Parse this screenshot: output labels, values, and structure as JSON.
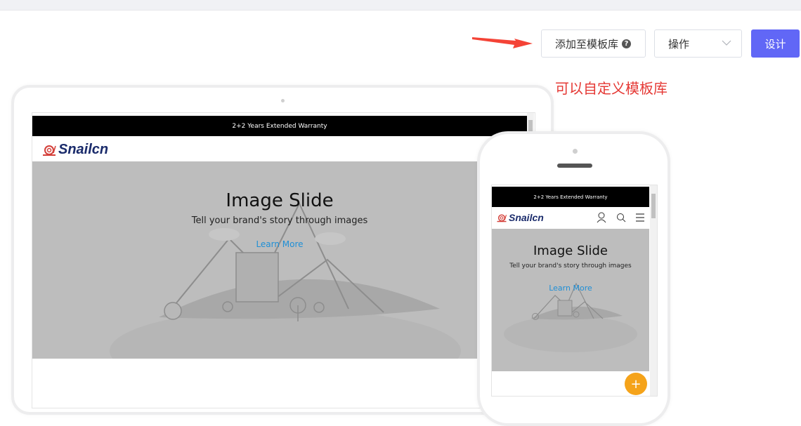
{
  "toolbar": {
    "add_template_label": "添加至模板库",
    "help_glyph": "?",
    "operations_label": "操作",
    "design_label": "设计"
  },
  "annotation": {
    "note": "可以自定义模板库"
  },
  "colors": {
    "primary": "#6167f6",
    "note_red": "#e53935",
    "arrow_red": "#f44336",
    "fab_orange": "#f5a31a",
    "hero_gray": "#bdbdbd"
  },
  "preview_desktop": {
    "announcement": "2+2 Years Extended Warranty",
    "logo": "Snailcn",
    "hero_title": "Image Slide",
    "hero_subtitle": "Tell your brand's story through images",
    "hero_link": "Learn More"
  },
  "preview_mobile": {
    "announcement": "2+2 Years Extended Warranty",
    "logo": "Snailcn",
    "hero_title": "Image Slide",
    "hero_subtitle": "Tell your brand's story through images",
    "hero_link": "Learn More",
    "fab_symbol": "+"
  },
  "icons": [
    "snail-logo-icon",
    "user-icon",
    "search-icon",
    "menu-icon",
    "help-icon",
    "chevron-down-icon"
  ]
}
